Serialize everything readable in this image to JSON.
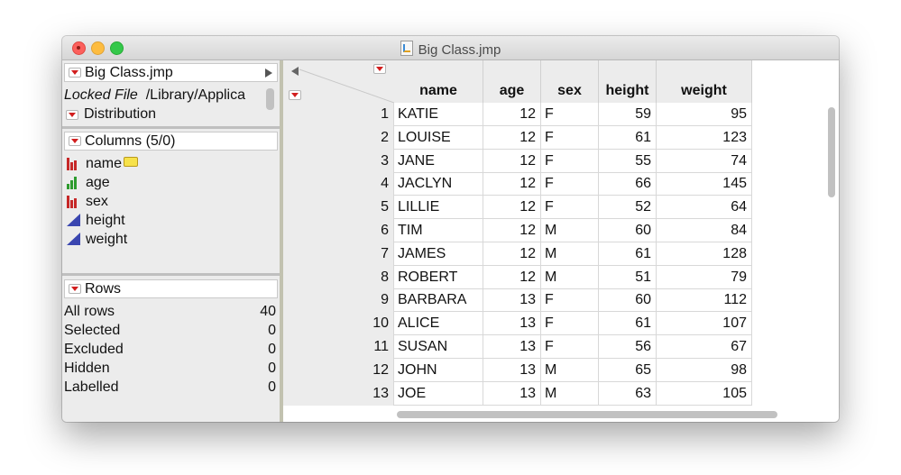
{
  "window": {
    "title": "Big Class.jmp"
  },
  "left": {
    "table_name": "Big Class.jmp",
    "locked_label": "Locked File",
    "locked_path": "/Library/Applica",
    "script": "Distribution",
    "columns_header": "Columns (5/0)",
    "columns": [
      {
        "name": "name",
        "type": "nominal"
      },
      {
        "name": "age",
        "type": "ordinal"
      },
      {
        "name": "sex",
        "type": "nominal"
      },
      {
        "name": "height",
        "type": "continuous"
      },
      {
        "name": "weight",
        "type": "continuous"
      }
    ],
    "rows_header": "Rows",
    "row_stats": [
      {
        "label": "All rows",
        "value": "40"
      },
      {
        "label": "Selected",
        "value": "0"
      },
      {
        "label": "Excluded",
        "value": "0"
      },
      {
        "label": "Hidden",
        "value": "0"
      },
      {
        "label": "Labelled",
        "value": "0"
      }
    ]
  },
  "grid": {
    "headers": [
      "name",
      "age",
      "sex",
      "height",
      "weight"
    ],
    "rows": [
      [
        "1",
        "KATIE",
        "12",
        "F",
        "59",
        "95"
      ],
      [
        "2",
        "LOUISE",
        "12",
        "F",
        "61",
        "123"
      ],
      [
        "3",
        "JANE",
        "12",
        "F",
        "55",
        "74"
      ],
      [
        "4",
        "JACLYN",
        "12",
        "F",
        "66",
        "145"
      ],
      [
        "5",
        "LILLIE",
        "12",
        "F",
        "52",
        "64"
      ],
      [
        "6",
        "TIM",
        "12",
        "M",
        "60",
        "84"
      ],
      [
        "7",
        "JAMES",
        "12",
        "M",
        "61",
        "128"
      ],
      [
        "8",
        "ROBERT",
        "12",
        "M",
        "51",
        "79"
      ],
      [
        "9",
        "BARBARA",
        "13",
        "F",
        "60",
        "112"
      ],
      [
        "10",
        "ALICE",
        "13",
        "F",
        "61",
        "107"
      ],
      [
        "11",
        "SUSAN",
        "13",
        "F",
        "56",
        "67"
      ],
      [
        "12",
        "JOHN",
        "13",
        "M",
        "65",
        "98"
      ],
      [
        "13",
        "JOE",
        "13",
        "M",
        "63",
        "105"
      ]
    ]
  },
  "colors": {
    "red_triangle": "#d21e1e",
    "continuous_icon": "#3a46b0",
    "nominal_icon": "#c62828",
    "ordinal_icon": "#2e9b2e"
  }
}
